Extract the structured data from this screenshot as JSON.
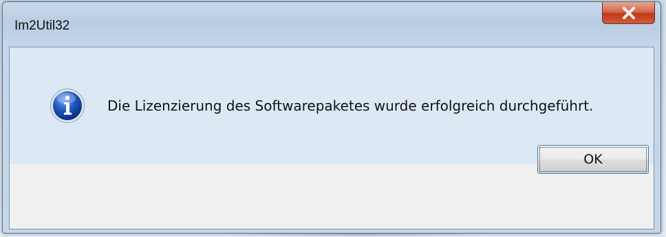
{
  "dialog": {
    "title": "Im2Util32",
    "message": "Die Lizenzierung des Softwarepaketes wurde erfolgreich durchgeführt.",
    "icon": "info-icon",
    "ok_label": "OK",
    "close_icon": "close-icon"
  },
  "colors": {
    "close_button": "#c0391c",
    "info_icon": "#1a4ea8",
    "content_background": "#dce9f4"
  }
}
